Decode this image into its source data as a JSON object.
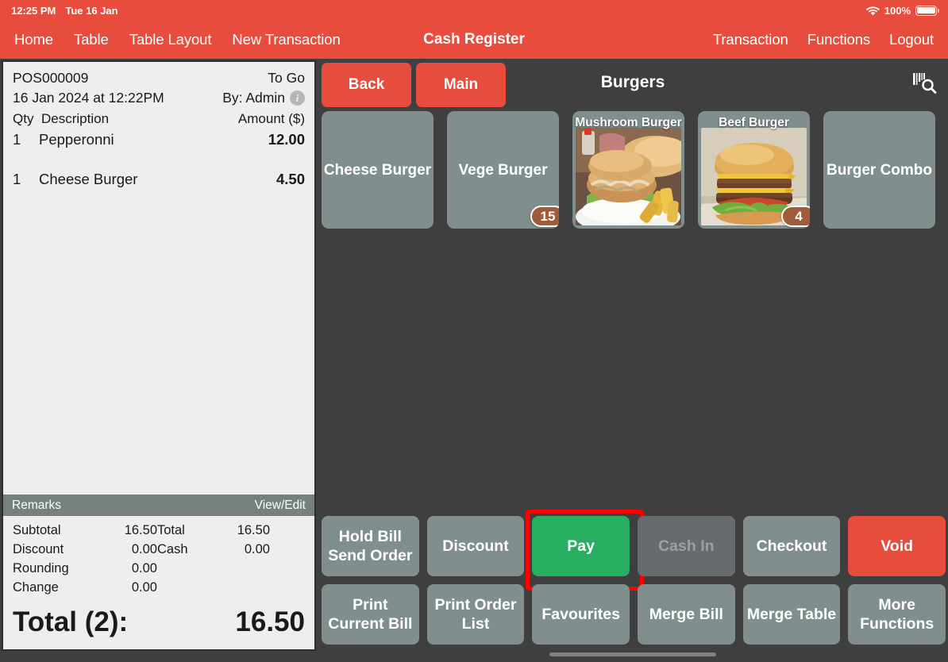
{
  "status_bar": {
    "time": "12:25 PM",
    "date": "Tue 16 Jan",
    "battery_percent": "100%",
    "wifi_icon": "wifi-icon",
    "battery_icon": "battery-full-icon"
  },
  "nav": {
    "title": "Cash Register",
    "left_items": [
      {
        "label": "Home"
      },
      {
        "label": "Table"
      },
      {
        "label": "Table Layout"
      },
      {
        "label": "New Transaction"
      }
    ],
    "right_items": [
      {
        "label": "Transaction"
      },
      {
        "label": "Functions"
      },
      {
        "label": "Logout"
      }
    ]
  },
  "receipt": {
    "order_no": "POS000009",
    "order_type": "To Go",
    "datetime": "16 Jan 2024 at 12:22PM",
    "operator": "By: Admin",
    "info_icon": "info-icon",
    "columns": {
      "qty": "Qty",
      "description": "Description",
      "amount": "Amount ($)"
    },
    "items": [
      {
        "qty": "1",
        "description": "Pepperonni",
        "amount": "12.00",
        "group_break_after": true
      },
      {
        "qty": "1",
        "description": "Cheese Burger",
        "amount": "4.50",
        "group_break_after": false
      }
    ],
    "remarks_label": "Remarks",
    "remarks_action": "View/Edit",
    "totals": [
      {
        "label": "Subtotal",
        "value": "16.50",
        "label2": "Total",
        "value2": "16.50"
      },
      {
        "label": "Discount",
        "value": "0.00",
        "label2": "Cash",
        "value2": "0.00"
      },
      {
        "label": "Rounding",
        "value": "0.00",
        "label2": "",
        "value2": ""
      },
      {
        "label": "Change",
        "value": "0.00",
        "label2": "",
        "value2": ""
      }
    ],
    "grand_total_label": "Total (2):",
    "grand_total_value": "16.50"
  },
  "catalog": {
    "title": "Burgers",
    "scan_icon": "barcode-scan-search-icon",
    "nav_buttons": [
      {
        "label": "Back"
      },
      {
        "label": "Main"
      }
    ],
    "tiles": [
      {
        "label": "Cheese Burger",
        "has_image": false,
        "badge": ""
      },
      {
        "label": "Vege Burger",
        "has_image": false,
        "badge": "15"
      },
      {
        "label": "Mushroom Burger",
        "has_image": true,
        "badge": ""
      },
      {
        "label": "Beef Burger",
        "has_image": true,
        "badge": "4"
      },
      {
        "label": "Burger Combo",
        "has_image": false,
        "badge": ""
      }
    ]
  },
  "actions": [
    {
      "label": "Hold Bill\nSend Order",
      "style": "normal",
      "disabled": false,
      "highlighted": false
    },
    {
      "label": "Discount",
      "style": "normal",
      "disabled": false,
      "highlighted": false
    },
    {
      "label": "Pay",
      "style": "green",
      "disabled": false,
      "highlighted": true
    },
    {
      "label": "Cash In",
      "style": "normal",
      "disabled": true,
      "highlighted": false
    },
    {
      "label": "Checkout",
      "style": "normal",
      "disabled": false,
      "highlighted": false
    },
    {
      "label": "Void",
      "style": "red",
      "disabled": false,
      "highlighted": false
    },
    {
      "label": "Print\nCurrent Bill",
      "style": "normal",
      "disabled": false,
      "highlighted": false
    },
    {
      "label": "Print Order\nList",
      "style": "normal",
      "disabled": false,
      "highlighted": false
    },
    {
      "label": "Favourites",
      "style": "normal",
      "disabled": false,
      "highlighted": false
    },
    {
      "label": "Merge Bill",
      "style": "normal",
      "disabled": false,
      "highlighted": false
    },
    {
      "label": "Merge Table",
      "style": "normal",
      "disabled": false,
      "highlighted": false
    },
    {
      "label": "More\nFunctions",
      "style": "normal",
      "disabled": false,
      "highlighted": false
    }
  ],
  "colors": {
    "brand_red": "#e84c3d",
    "tile_gray": "#818e8e",
    "dark_bg": "#3f3f3f",
    "pay_green": "#27ae60",
    "badge_brown": "#a05b38",
    "highlight_red": "#ff0000",
    "remarks_bar": "#76807f",
    "receipt_paper": "#eeeeec"
  }
}
